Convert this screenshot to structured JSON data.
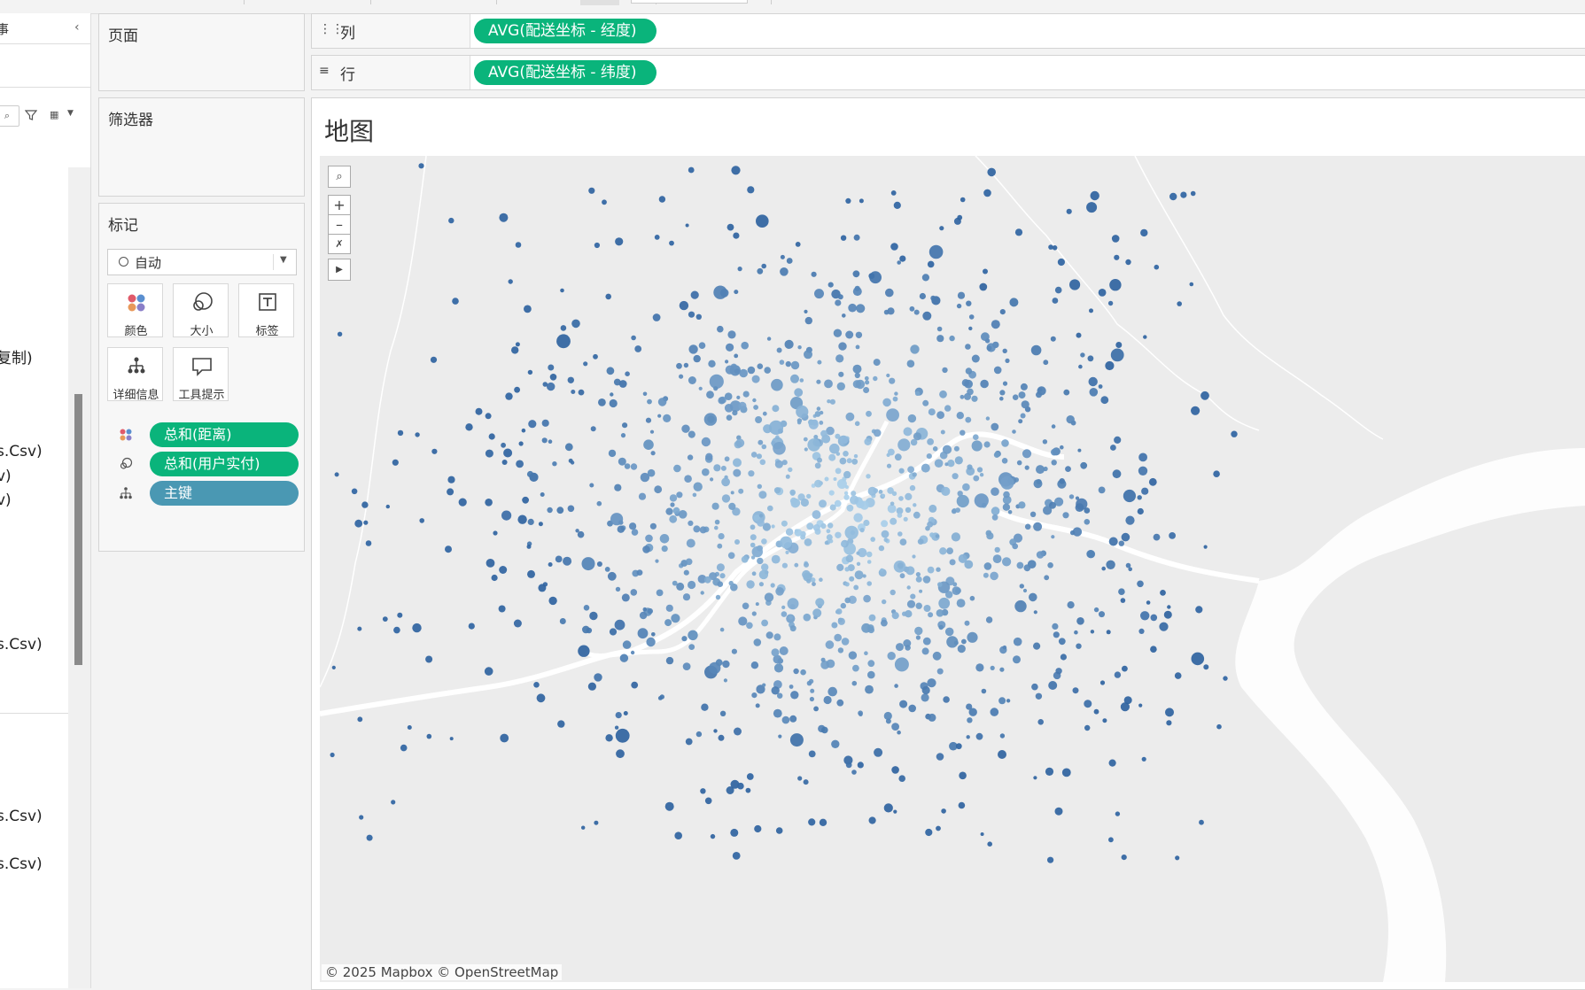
{
  "data_pane": {
    "title_fragment": "事",
    "collapse_glyph": "‹",
    "search_icon": "search-icon",
    "field_fragments": [
      "复制)",
      "s.Csv)",
      "v)",
      "v)",
      "s.Csv)",
      "s.Csv)",
      "s.Csv)"
    ]
  },
  "cards": {
    "pages_title": "页面",
    "filters_title": "筛选器",
    "marks_title": "标记"
  },
  "marks": {
    "mark_type": "自动",
    "buttons": [
      {
        "label": "颜色",
        "icon": "color-icon"
      },
      {
        "label": "大小",
        "icon": "size-icon"
      },
      {
        "label": "标签",
        "icon": "label-icon"
      },
      {
        "label": "详细信息",
        "icon": "detail-icon"
      },
      {
        "label": "工具提示",
        "icon": "tooltip-icon"
      }
    ],
    "pills": [
      {
        "icon": "color-icon",
        "text": "总和(距离)",
        "color": "#0ab47b"
      },
      {
        "icon": "size-icon",
        "text": "总和(用户实付)",
        "color": "#0ab47b"
      },
      {
        "icon": "detail-icon",
        "text": "主键",
        "color": "#4a98b3"
      }
    ]
  },
  "shelves": {
    "columns": {
      "icon": "columns-icon",
      "label": "列",
      "pill": "AVG(配送坐标 - 经度)"
    },
    "rows": {
      "icon": "rows-icon",
      "label": "行",
      "pill": "AVG(配送坐标 - 纬度)"
    }
  },
  "sheet": {
    "title": "地图",
    "attribution": "© 2025 Mapbox © OpenStreetMap",
    "map_tools": [
      "search-icon",
      "zoom-in-icon",
      "zoom-out-icon",
      "clear-selection-icon",
      "expand-toolbar-icon"
    ]
  },
  "colors": {
    "green_pill": "#0ab47b",
    "blue_pill": "#4a98b3",
    "point_light": "#a9cfea",
    "point_dark": "#2f63a0",
    "map_bg": "#eaeaea",
    "river": "#ffffff"
  }
}
